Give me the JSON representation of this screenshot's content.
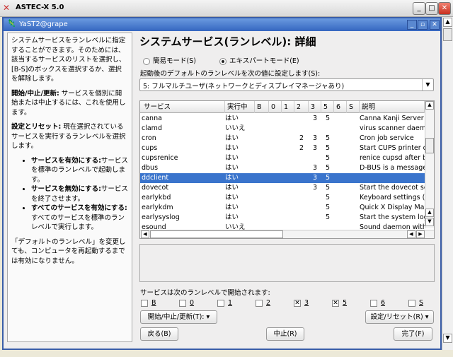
{
  "outer_window": {
    "title": "ASTEC-X 5.0",
    "controls": [
      "minimize",
      "maximize",
      "close"
    ]
  },
  "inner_window": {
    "title": "YaST2@grape"
  },
  "help": {
    "p1": "システムサービスをランレベルに指定することができます。そのためには、該当するサービスのリストを選択し、[B-S]のボックスを選択するか、選択を解除します。",
    "p2_bold": "開始/中止/更新:",
    "p2": " サービスを個別に開始または中止するには、これを使用します。",
    "p3_bold": "設定とリセット:",
    "p3": " 現在選択されているサービスを実行するランレベルを選択します。",
    "bullets": [
      {
        "bold": "サービスを有効にする:",
        "text": "サービスを標準のランレベルで起動します。"
      },
      {
        "bold": "サービスを無効にする:",
        "text": "サービスを終了させます。"
      },
      {
        "bold": "すべてのサービスを有効にする:",
        "text": "すべてのサービスを標準のランレベルで実行します。"
      }
    ],
    "p4": "「デフォルトのランレベル」を変更しても、コンピュータを再起動するまでは有効になりません。"
  },
  "main": {
    "title": "システムサービス(ランレベル): 詳細",
    "mode_simple": "簡易モード(S)",
    "mode_expert": "エキスパートモード(E)",
    "selected_mode": "expert",
    "default_label": "起動後のデフォルトのランレベルを次の値に設定します(S):",
    "default_value": "5: フルマルチユーザ(ネットワークとディスプレイマネージャあり)",
    "table": {
      "headers": [
        "サービス",
        "実行中",
        "B",
        "0",
        "1",
        "2",
        "3",
        "5",
        "6",
        "S",
        "説明"
      ],
      "rows": [
        [
          "canna",
          "はい",
          "",
          "",
          "",
          "",
          "3",
          "5",
          "",
          "",
          "Canna Kanji Server"
        ],
        [
          "clamd",
          "いいえ",
          "",
          "",
          "",
          "",
          "",
          "",
          "",
          "",
          "virus scanner daemon"
        ],
        [
          "cron",
          "はい",
          "",
          "",
          "",
          "2",
          "3",
          "5",
          "",
          "",
          "Cron job service"
        ],
        [
          "cups",
          "はい",
          "",
          "",
          "",
          "2",
          "3",
          "5",
          "",
          "",
          "Start CUPS printer daemon"
        ],
        [
          "cupsrenice",
          "はい",
          "",
          "",
          "",
          "",
          "",
          "5",
          "",
          "",
          "renice cupsd after boot"
        ],
        [
          "dbus",
          "はい",
          "",
          "",
          "",
          "",
          "3",
          "5",
          "",
          "",
          "D-BUS is a message bus"
        ],
        [
          "ddclient",
          "はい",
          "",
          "",
          "",
          "",
          "3",
          "5",
          "",
          "",
          ""
        ],
        [
          "dovecot",
          "はい",
          "",
          "",
          "",
          "",
          "3",
          "5",
          "",
          "",
          "Start the dovecot server"
        ],
        [
          "earlykbd",
          "はい",
          "",
          "",
          "",
          "",
          "",
          "5",
          "",
          "",
          "Keyboard settings (early)"
        ],
        [
          "earlykdm",
          "はい",
          "",
          "",
          "",
          "",
          "",
          "5",
          "",
          "",
          "Quick X Display Manager"
        ],
        [
          "earlysyslog",
          "はい",
          "",
          "",
          "",
          "",
          "",
          "5",
          "",
          "",
          "Start the system log"
        ],
        [
          "esound",
          "いいえ",
          "",
          "",
          "",
          "",
          "",
          "",
          "",
          "",
          "Sound daemon with"
        ]
      ],
      "selected_row": 6
    },
    "runlevel_label": "サービスは次のランレベルで開始されます:",
    "runlevels": [
      {
        "label": "B",
        "checked": false
      },
      {
        "label": "0",
        "checked": false
      },
      {
        "label": "1",
        "checked": false
      },
      {
        "label": "2",
        "checked": false
      },
      {
        "label": "3",
        "checked": true
      },
      {
        "label": "5",
        "checked": true
      },
      {
        "label": "6",
        "checked": false
      },
      {
        "label": "S",
        "checked": false
      }
    ],
    "start_stop_button": "開始/中止/更新(T):",
    "set_reset_button": "設定/リセット(R)",
    "back_button": "戻る(B)",
    "abort_button": "中止(R)",
    "finish_button": "完了(F)"
  },
  "colors": {
    "selection": "#3a74cc",
    "title_bar": "#3566c0"
  }
}
